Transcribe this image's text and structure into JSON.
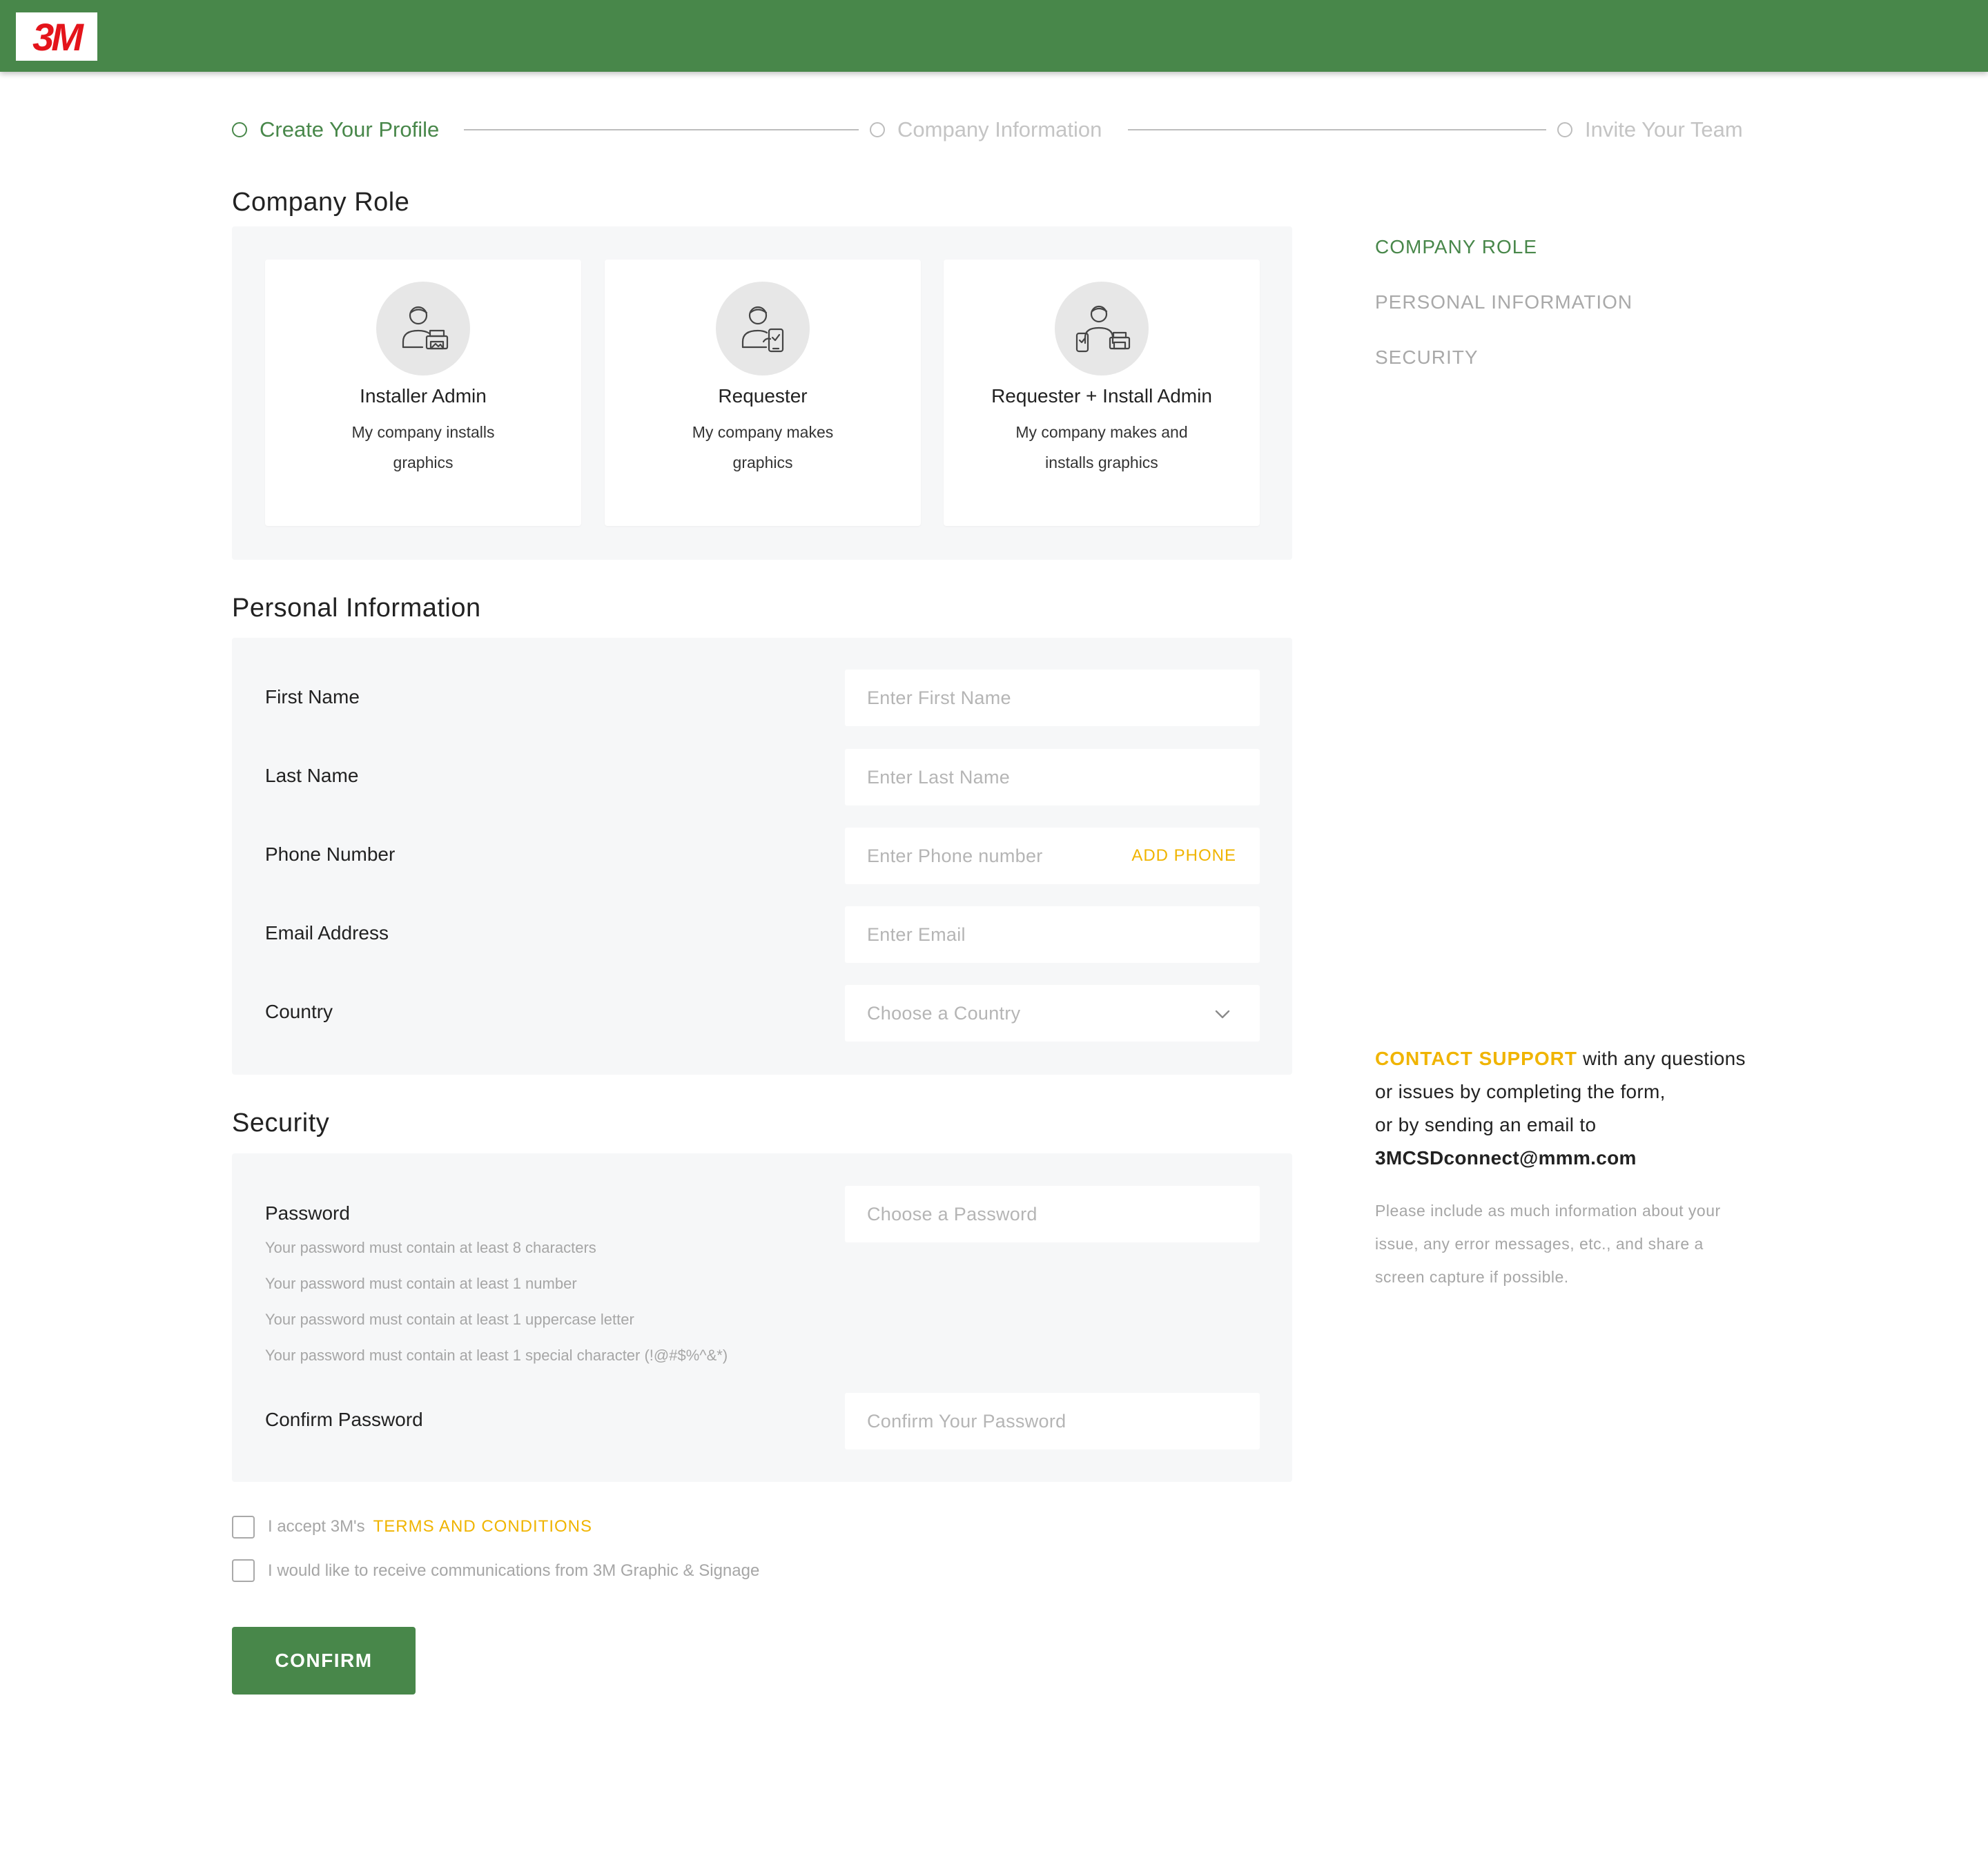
{
  "header": {
    "logo_text": "3M",
    "brand_color": "#48874a",
    "logo_color": "#e4141b"
  },
  "stepper": {
    "steps": [
      {
        "label": "Create Your Profile",
        "active": true
      },
      {
        "label": "Company Information",
        "active": false
      },
      {
        "label": "Invite Your Team",
        "active": false
      }
    ]
  },
  "company_role": {
    "title": "Company Role",
    "options": [
      {
        "title": "Installer Admin",
        "desc_line1": "My company installs",
        "desc_line2": "graphics",
        "icon": "installer-admin-icon"
      },
      {
        "title": "Requester",
        "desc_line1": "My company makes",
        "desc_line2": "graphics",
        "icon": "requester-icon"
      },
      {
        "title": "Requester + Install Admin",
        "desc_line1": "My company makes and",
        "desc_line2": "installs graphics",
        "icon": "requester-install-admin-icon"
      }
    ]
  },
  "personal_info": {
    "title": "Personal Information",
    "first_name": {
      "label": "First Name",
      "placeholder": "Enter First Name"
    },
    "last_name": {
      "label": "Last Name",
      "placeholder": "Enter Last Name"
    },
    "phone": {
      "label": "Phone Number",
      "placeholder": "Enter Phone number",
      "action": "ADD PHONE"
    },
    "email": {
      "label": "Email Address",
      "placeholder": "Enter Email"
    },
    "country": {
      "label": "Country",
      "placeholder": "Choose a Country"
    }
  },
  "security": {
    "title": "Security",
    "password": {
      "label": "Password",
      "placeholder": "Choose a Password"
    },
    "rules": [
      "Your password must contain at least 8 characters",
      "Your password must contain at least 1 number",
      "Your password must contain at least 1 uppercase letter",
      "Your password must contain at least 1 special character (!@#$%^&*)"
    ],
    "confirm": {
      "label": "Confirm Password",
      "placeholder": "Confirm Your Password"
    }
  },
  "agreements": {
    "terms_prefix": "I accept 3M's",
    "terms_link": "TERMS AND CONDITIONS",
    "communications": "I would like to receive communications from 3M Graphic & Signage"
  },
  "confirm_button": "CONFIRM",
  "side_nav": {
    "items": [
      {
        "label": "COMPANY ROLE",
        "active": true
      },
      {
        "label": "PERSONAL INFORMATION",
        "active": false
      },
      {
        "label": "SECURITY",
        "active": false
      }
    ]
  },
  "support": {
    "link": "CONTACT SUPPORT",
    "line1_rest": " with any questions",
    "line2": "or issues by completing the form,",
    "line3": "or by sending an email to",
    "email": "3MCSDconnect@mmm.com",
    "note_line1": "Please include as much information about your",
    "note_line2": "issue, any error messages, etc., and share a",
    "note_line3": "screen capture if possible."
  }
}
